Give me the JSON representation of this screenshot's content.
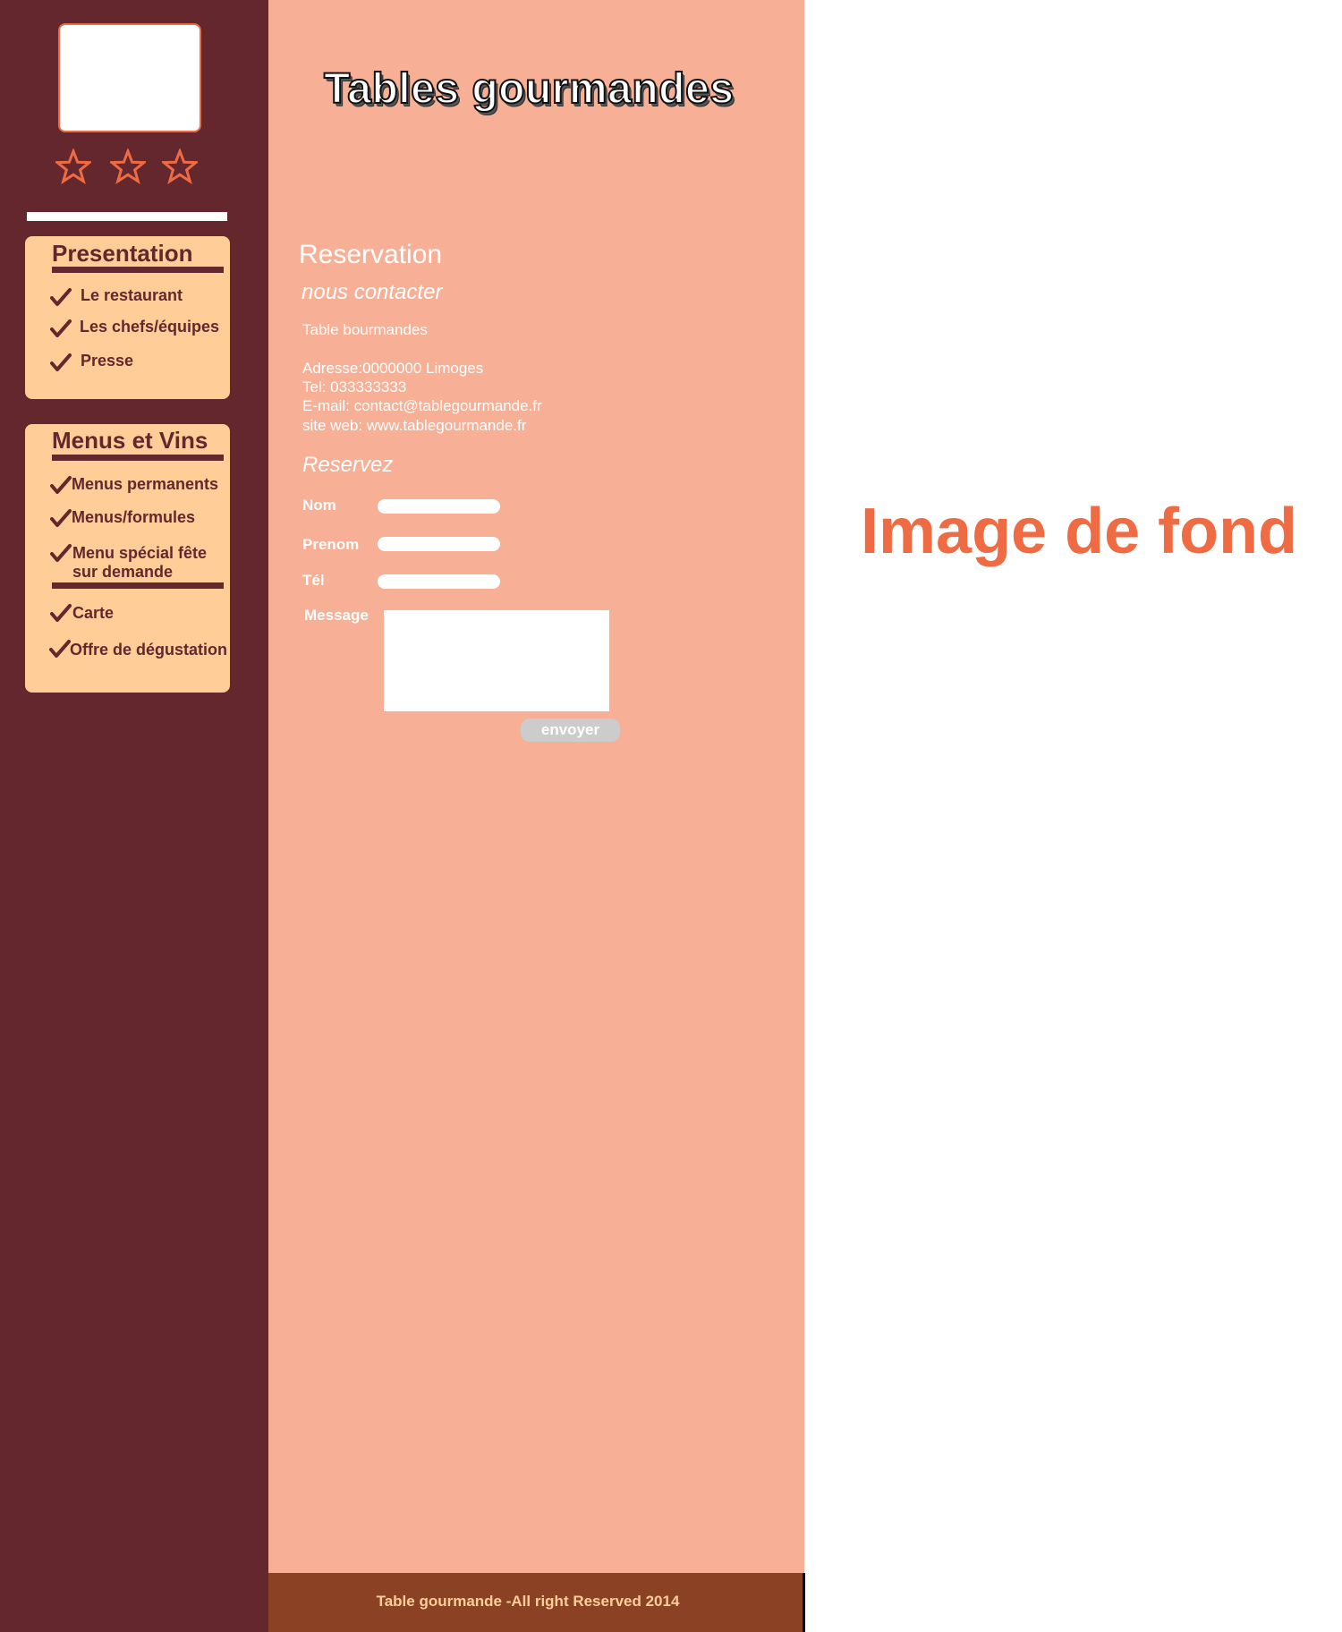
{
  "site": {
    "title": "Tables gourmandes",
    "rating_stars": 3
  },
  "colors": {
    "sidebar_bg": "#63272d",
    "menu_box_bg": "#ffce98",
    "main_bg": "#f7b096",
    "accent": "#ee6b44",
    "footer_bg": "#8a4124",
    "button_bg": "#cccccc"
  },
  "icons": {
    "star": "star-outline-icon",
    "check": "checkmark-icon"
  },
  "sidebar": {
    "presentation": {
      "title": "Presentation",
      "items": [
        {
          "label": "Le restaurant"
        },
        {
          "label": "Les chefs/équipes"
        },
        {
          "label": "Presse"
        }
      ]
    },
    "menus": {
      "title": "Menus et Vins",
      "items": [
        {
          "label": "Menus permanents"
        },
        {
          "label": "Menus/formules"
        },
        {
          "label": "Menu spécial fête",
          "label2": "sur demande"
        },
        {
          "label": "Carte"
        },
        {
          "label": "Offre de dégustation"
        }
      ]
    }
  },
  "main": {
    "heading": "Reservation",
    "contact": {
      "heading": "nous contacter",
      "name": "Table bourmandes",
      "address": "Adresse:0000000 Limoges",
      "tel": "Tel: 033333333",
      "email": "E-mail: contact@tablegourmande.fr",
      "website": "site web: www.tablegourmande.fr"
    },
    "form": {
      "heading": "Reservez",
      "nom_label": "Nom",
      "nom_value": "",
      "prenom_label": "Prenom",
      "prenom_value": "",
      "tel_label": "Tél",
      "tel_value": "",
      "message_label": "Message",
      "message_value": "",
      "submit_label": "envoyer"
    }
  },
  "footer": {
    "text": "Table gourmande -All right Reserved  2014"
  },
  "background_placeholder": "Image de fond"
}
